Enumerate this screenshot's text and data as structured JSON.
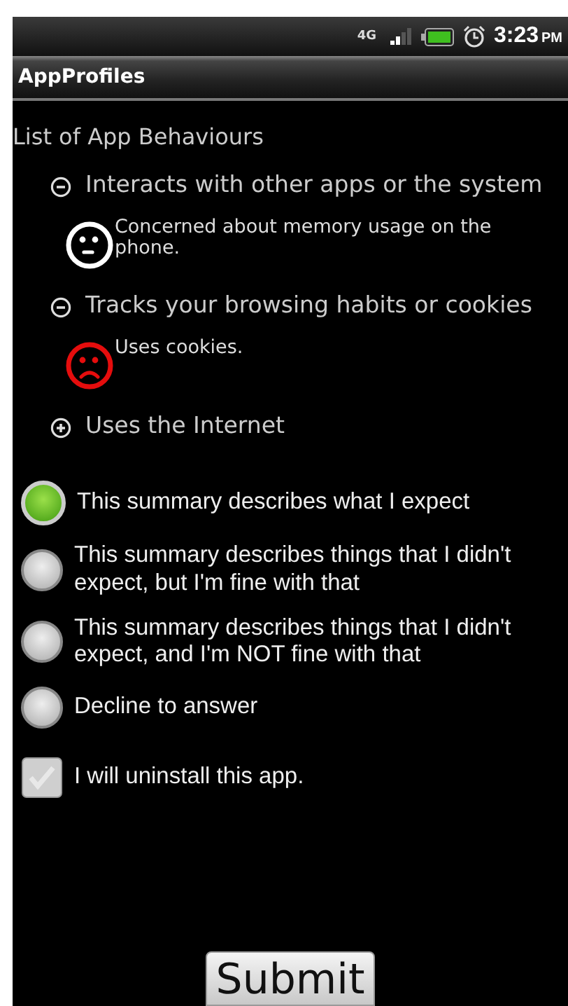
{
  "status_bar": {
    "network": "4G",
    "time": "3:23",
    "ampm": "PM"
  },
  "title_bar": {
    "title": "AppProfiles"
  },
  "behaviours": {
    "heading": "List of App Behaviours",
    "groups": [
      {
        "label": "Interacts with other apps or the system",
        "expanded": true,
        "children": [
          {
            "kind": "neutral",
            "text": "Concerned about memory usage on the phone."
          }
        ]
      },
      {
        "label": "Tracks your browsing habits or cookies",
        "expanded": true,
        "children": [
          {
            "kind": "sad",
            "text": "Uses cookies."
          }
        ]
      },
      {
        "label": "Uses the Internet",
        "expanded": false
      }
    ]
  },
  "options": [
    {
      "label": "This summary describes what I expect",
      "selected": true
    },
    {
      "label": "This summary describes things that I didn't expect, but I'm fine with that",
      "selected": false
    },
    {
      "label": "This summary describes things that I didn't expect, and I'm NOT fine with that",
      "selected": false
    },
    {
      "label": "Decline to answer",
      "selected": false
    }
  ],
  "uninstall": {
    "label": "I will uninstall this app.",
    "checked": false
  },
  "submit": {
    "label": "Submit"
  }
}
